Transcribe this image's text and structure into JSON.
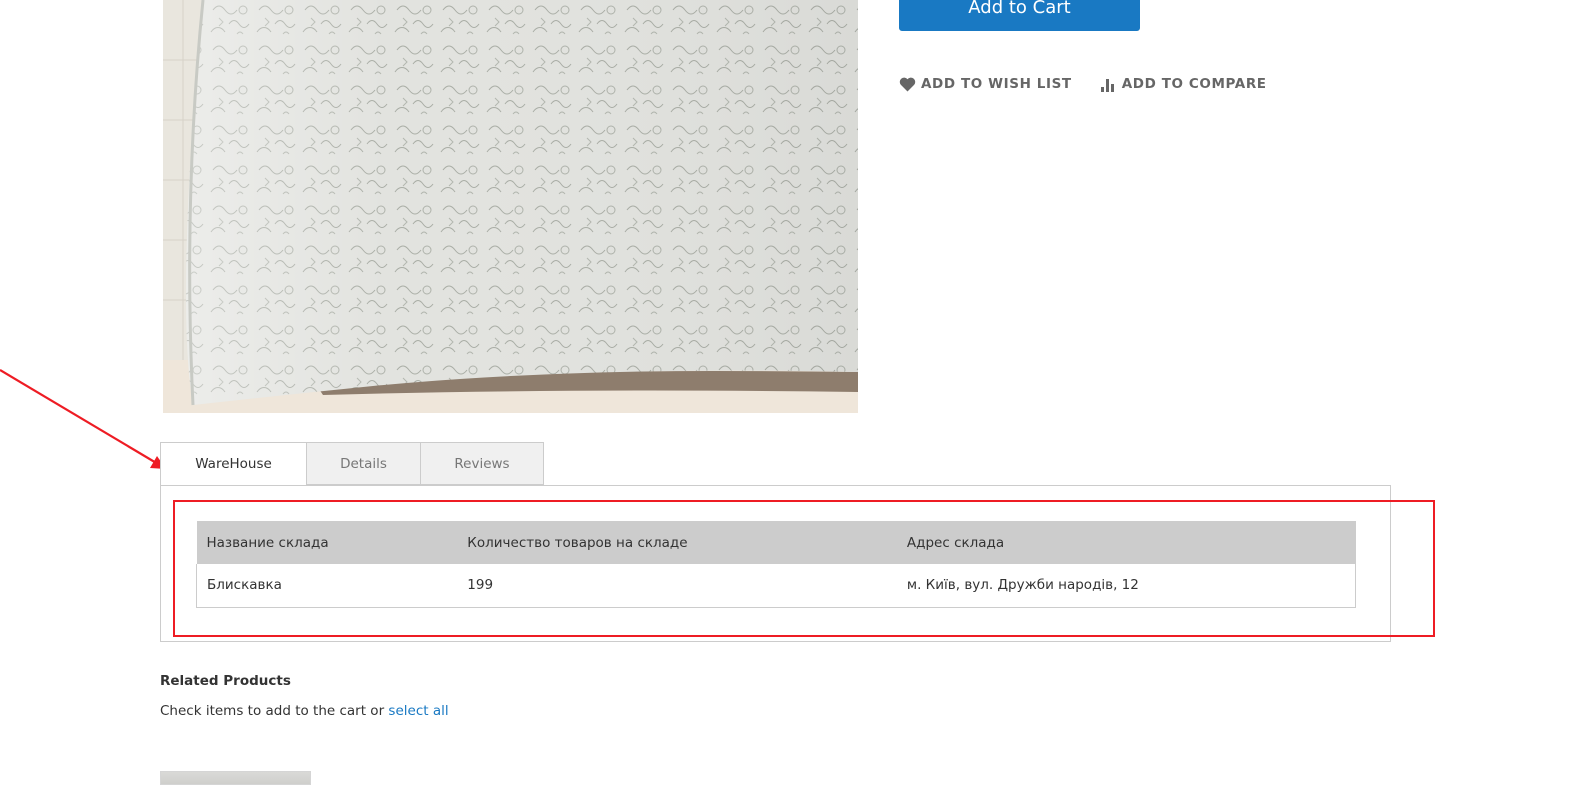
{
  "product": {
    "image_alt": "Quilted bed cover photo",
    "add_to_cart_label": "Add to Cart",
    "wishlist_label": "ADD TO WISH LIST",
    "compare_label": "ADD TO COMPARE"
  },
  "tabs": [
    {
      "label": "WareHouse",
      "active": true
    },
    {
      "label": "Details",
      "active": false
    },
    {
      "label": "Reviews",
      "active": false
    }
  ],
  "warehouse_table": {
    "headers": [
      "Название склада",
      "Количество товаров на складе",
      "Адрес склада"
    ],
    "rows": [
      [
        "Блискавка",
        "199",
        "м. Київ, вул. Дружби народів, 12"
      ]
    ]
  },
  "related": {
    "title": "Related Products",
    "hint_text": "Check items to add to the cart or",
    "select_all_label": "select all"
  },
  "colors": {
    "accent": "#1979c3",
    "annotation": "#ee1c24",
    "table_header": "#cccccc"
  }
}
